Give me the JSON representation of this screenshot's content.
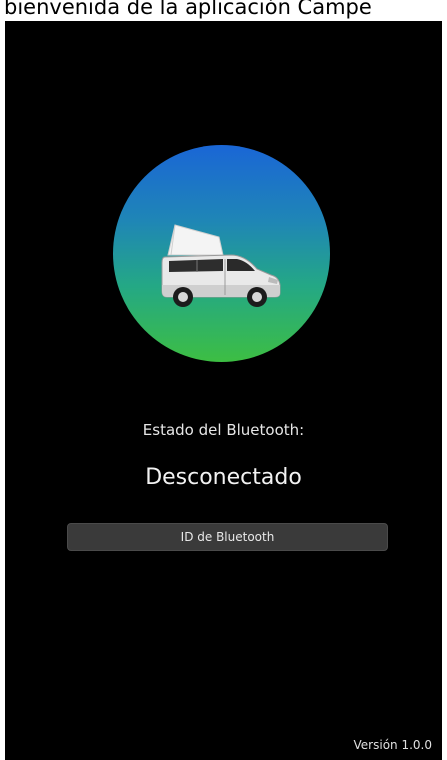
{
  "banner": {
    "text": "bienvenida de la aplicación Campe"
  },
  "logo": {
    "icon": "campervan-icon",
    "gradient_top": "#1a66d6",
    "gradient_bottom": "#3dbe43"
  },
  "bluetooth": {
    "state_label": "Estado del Bluetooth:",
    "state_value": "Desconectado",
    "id_button_label": "ID de Bluetooth"
  },
  "footer": {
    "version": "Versión 1.0.0"
  }
}
